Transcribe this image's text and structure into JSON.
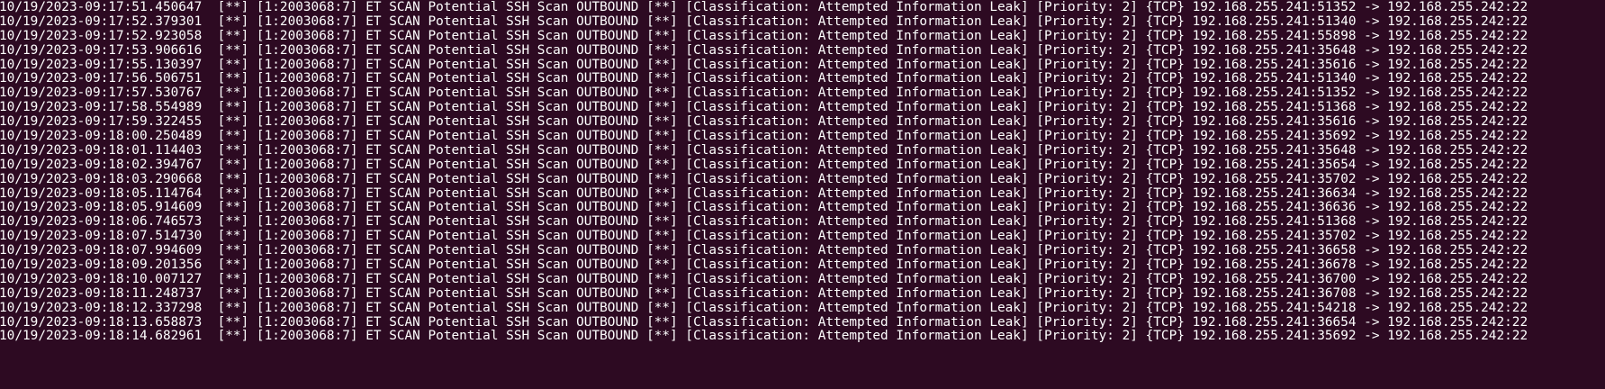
{
  "terminal": {
    "lines": [
      "10/19/2023-09:17:51.450647  [**] [1:2003068:7] ET SCAN Potential SSH Scan OUTBOUND [**] [Classification: Attempted Information Leak] [Priority: 2] {TCP} 192.168.255.241:51352 -> 192.168.255.242:22",
      "10/19/2023-09:17:52.379301  [**] [1:2003068:7] ET SCAN Potential SSH Scan OUTBOUND [**] [Classification: Attempted Information Leak] [Priority: 2] {TCP} 192.168.255.241:51340 -> 192.168.255.242:22",
      "10/19/2023-09:17:52.923058  [**] [1:2003068:7] ET SCAN Potential SSH Scan OUTBOUND [**] [Classification: Attempted Information Leak] [Priority: 2] {TCP} 192.168.255.241:55898 -> 192.168.255.242:22",
      "10/19/2023-09:17:53.906616  [**] [1:2003068:7] ET SCAN Potential SSH Scan OUTBOUND [**] [Classification: Attempted Information Leak] [Priority: 2] {TCP} 192.168.255.241:35648 -> 192.168.255.242:22",
      "10/19/2023-09:17:55.130397  [**] [1:2003068:7] ET SCAN Potential SSH Scan OUTBOUND [**] [Classification: Attempted Information Leak] [Priority: 2] {TCP} 192.168.255.241:35616 -> 192.168.255.242:22",
      "10/19/2023-09:17:56.506751  [**] [1:2003068:7] ET SCAN Potential SSH Scan OUTBOUND [**] [Classification: Attempted Information Leak] [Priority: 2] {TCP} 192.168.255.241:51340 -> 192.168.255.242:22",
      "10/19/2023-09:17:57.530767  [**] [1:2003068:7] ET SCAN Potential SSH Scan OUTBOUND [**] [Classification: Attempted Information Leak] [Priority: 2] {TCP} 192.168.255.241:51352 -> 192.168.255.242:22",
      "10/19/2023-09:17:58.554989  [**] [1:2003068:7] ET SCAN Potential SSH Scan OUTBOUND [**] [Classification: Attempted Information Leak] [Priority: 2] {TCP} 192.168.255.241:51368 -> 192.168.255.242:22",
      "10/19/2023-09:17:59.322455  [**] [1:2003068:7] ET SCAN Potential SSH Scan OUTBOUND [**] [Classification: Attempted Information Leak] [Priority: 2] {TCP} 192.168.255.241:35616 -> 192.168.255.242:22",
      "10/19/2023-09:18:00.250489  [**] [1:2003068:7] ET SCAN Potential SSH Scan OUTBOUND [**] [Classification: Attempted Information Leak] [Priority: 2] {TCP} 192.168.255.241:35692 -> 192.168.255.242:22",
      "10/19/2023-09:18:01.114403  [**] [1:2003068:7] ET SCAN Potential SSH Scan OUTBOUND [**] [Classification: Attempted Information Leak] [Priority: 2] {TCP} 192.168.255.241:35648 -> 192.168.255.242:22",
      "10/19/2023-09:18:02.394767  [**] [1:2003068:7] ET SCAN Potential SSH Scan OUTBOUND [**] [Classification: Attempted Information Leak] [Priority: 2] {TCP} 192.168.255.241:35654 -> 192.168.255.242:22",
      "10/19/2023-09:18:03.290668  [**] [1:2003068:7] ET SCAN Potential SSH Scan OUTBOUND [**] [Classification: Attempted Information Leak] [Priority: 2] {TCP} 192.168.255.241:35702 -> 192.168.255.242:22",
      "10/19/2023-09:18:05.114764  [**] [1:2003068:7] ET SCAN Potential SSH Scan OUTBOUND [**] [Classification: Attempted Information Leak] [Priority: 2] {TCP} 192.168.255.241:36634 -> 192.168.255.242:22",
      "10/19/2023-09:18:05.914609  [**] [1:2003068:7] ET SCAN Potential SSH Scan OUTBOUND [**] [Classification: Attempted Information Leak] [Priority: 2] {TCP} 192.168.255.241:36636 -> 192.168.255.242:22",
      "10/19/2023-09:18:06.746573  [**] [1:2003068:7] ET SCAN Potential SSH Scan OUTBOUND [**] [Classification: Attempted Information Leak] [Priority: 2] {TCP} 192.168.255.241:51368 -> 192.168.255.242:22",
      "10/19/2023-09:18:07.514730  [**] [1:2003068:7] ET SCAN Potential SSH Scan OUTBOUND [**] [Classification: Attempted Information Leak] [Priority: 2] {TCP} 192.168.255.241:35702 -> 192.168.255.242:22",
      "10/19/2023-09:18:07.994609  [**] [1:2003068:7] ET SCAN Potential SSH Scan OUTBOUND [**] [Classification: Attempted Information Leak] [Priority: 2] {TCP} 192.168.255.241:36658 -> 192.168.255.242:22",
      "10/19/2023-09:18:09.201356  [**] [1:2003068:7] ET SCAN Potential SSH Scan OUTBOUND [**] [Classification: Attempted Information Leak] [Priority: 2] {TCP} 192.168.255.241:36678 -> 192.168.255.242:22",
      "10/19/2023-09:18:10.007127  [**] [1:2003068:7] ET SCAN Potential SSH Scan OUTBOUND [**] [Classification: Attempted Information Leak] [Priority: 2] {TCP} 192.168.255.241:36700 -> 192.168.255.242:22",
      "10/19/2023-09:18:11.248737  [**] [1:2003068:7] ET SCAN Potential SSH Scan OUTBOUND [**] [Classification: Attempted Information Leak] [Priority: 2] {TCP} 192.168.255.241:36708 -> 192.168.255.242:22",
      "10/19/2023-09:18:12.337298  [**] [1:2003068:7] ET SCAN Potential SSH Scan OUTBOUND [**] [Classification: Attempted Information Leak] [Priority: 2] {TCP} 192.168.255.241:54218 -> 192.168.255.242:22",
      "10/19/2023-09:18:13.658873  [**] [1:2003068:7] ET SCAN Potential SSH Scan OUTBOUND [**] [Classification: Attempted Information Leak] [Priority: 2] {TCP} 192.168.255.241:36654 -> 192.168.255.242:22",
      "10/19/2023-09:18:14.682961  [**] [1:2003068:7] ET SCAN Potential SSH Scan OUTBOUND [**] [Classification: Attempted Information Leak] [Priority: 2] {TCP} 192.168.255.241:35692 -> 192.168.255.242:22"
    ],
    "colors": {
      "background": "#2d0a22",
      "text": "#ffffff"
    }
  }
}
